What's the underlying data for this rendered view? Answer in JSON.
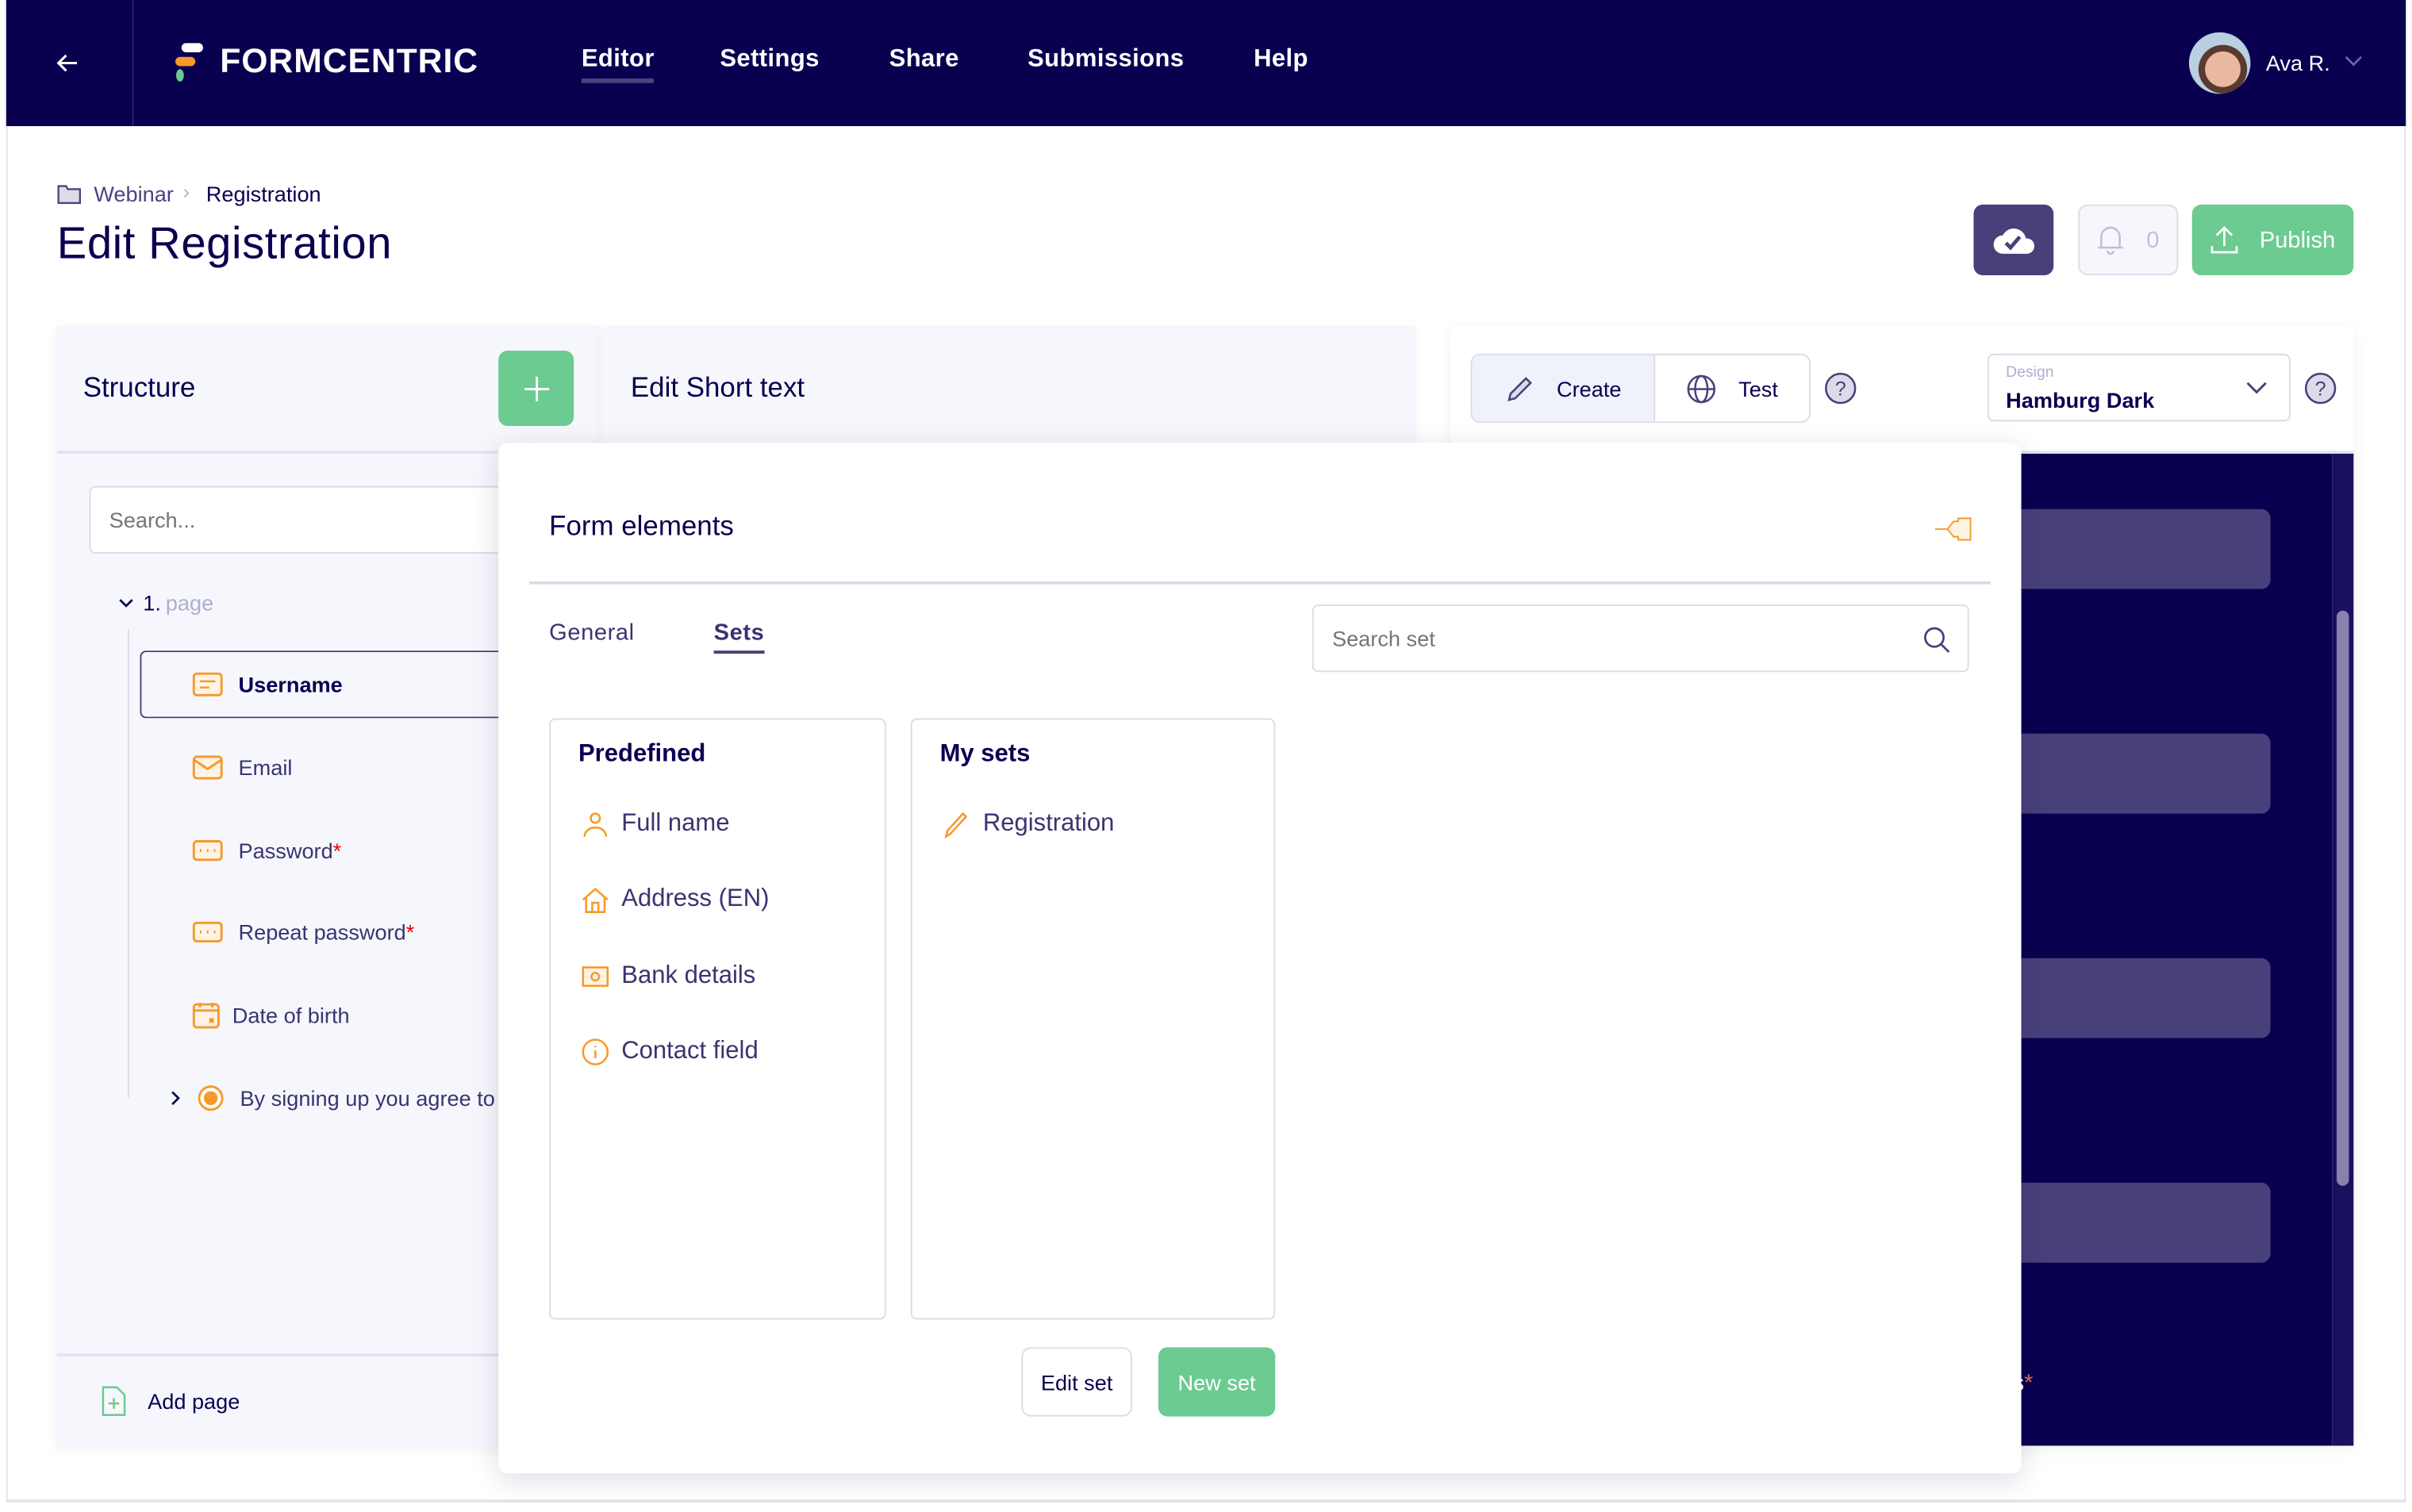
{
  "nav": {
    "brand": "FORMCENTRIC",
    "items": [
      {
        "label": "Editor",
        "active": true
      },
      {
        "label": "Settings"
      },
      {
        "label": "Share"
      },
      {
        "label": "Submissions"
      },
      {
        "label": "Help"
      }
    ],
    "user": "Ava R."
  },
  "breadcrumb": {
    "parent": "Webinar",
    "current": "Registration"
  },
  "page_title": "Edit Registration",
  "toolbar": {
    "notification_count": "0",
    "publish_label": "Publish"
  },
  "structure": {
    "title": "Structure",
    "search_placeholder": "Search...",
    "page_number": "1.",
    "page_label": "page",
    "items": [
      {
        "label": "Username",
        "icon": "short-text-icon"
      },
      {
        "label": "Email",
        "icon": "email-icon"
      },
      {
        "label": "Password",
        "required": "*",
        "icon": "password-icon"
      },
      {
        "label": "Repeat password",
        "required": "*",
        "icon": "password-icon"
      },
      {
        "label": "Date of birth",
        "icon": "calendar-icon"
      },
      {
        "label": "By signing up you agree to",
        "icon": "radio-icon"
      }
    ],
    "add_page": "Add page"
  },
  "edit_panel": {
    "title": "Edit Short text"
  },
  "preview": {
    "modes": [
      "Create",
      "Test"
    ],
    "design_label": "Design",
    "design_value": "Hamburg Dark",
    "partial_text": "ns",
    "required": "*"
  },
  "form_elements": {
    "title": "Form elements",
    "tabs": [
      "General",
      "Sets"
    ],
    "active_tab": "Sets",
    "search_placeholder": "Search set",
    "predefined": {
      "title": "Predefined",
      "items": [
        {
          "label": "Full name",
          "icon": "user-icon"
        },
        {
          "label": "Address (EN)",
          "icon": "house-icon"
        },
        {
          "label": "Bank details",
          "icon": "banknote-icon"
        },
        {
          "label": "Contact field",
          "icon": "info-icon"
        }
      ]
    },
    "my_sets": {
      "title": "My sets",
      "items": [
        {
          "label": "Registration",
          "icon": "pencil-icon"
        }
      ]
    },
    "edit_set": "Edit set",
    "new_set": "New set"
  },
  "colors": {
    "nav": "#0a0050",
    "accent_green": "#6ccb91",
    "accent_orange": "#f59a2a",
    "purple": "#48407a"
  }
}
